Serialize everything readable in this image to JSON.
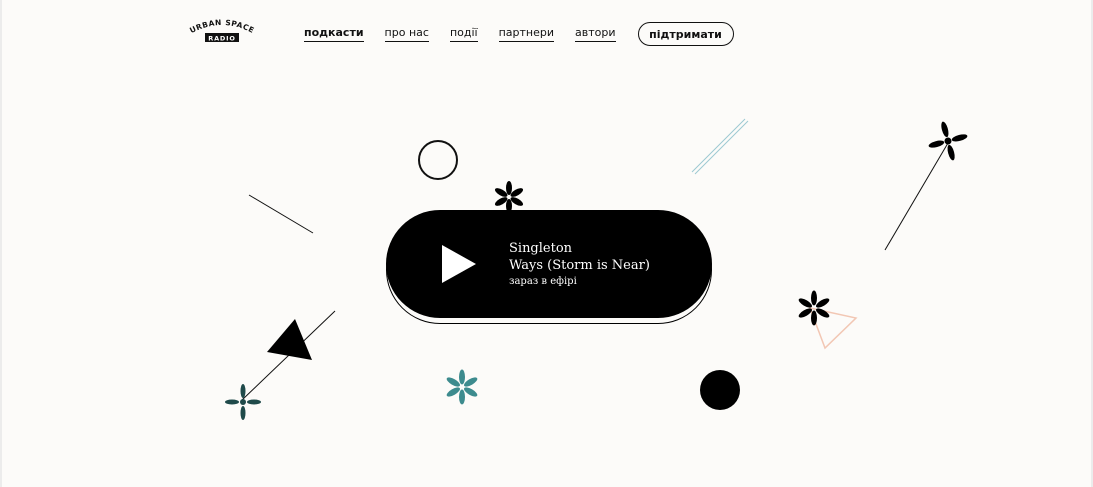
{
  "logo": {
    "top_text": "URBAN SPACE",
    "badge_text": "RADIO"
  },
  "nav": {
    "items": [
      {
        "label": "подкасти",
        "active": true
      },
      {
        "label": "про нас"
      },
      {
        "label": "події"
      },
      {
        "label": "партнери"
      },
      {
        "label": "автори"
      }
    ],
    "support_label": "підтримати"
  },
  "player": {
    "artist": "Singleton",
    "title": "Ways (Storm is Near)",
    "status": "зараз в ефірі"
  },
  "colors": {
    "background": "#fcfbf9",
    "ink": "#000000",
    "teal": "#3d8b8e",
    "dark_teal": "#1f4a4a",
    "peach": "#f2c7b4",
    "light_blue": "#9cc9d2"
  }
}
